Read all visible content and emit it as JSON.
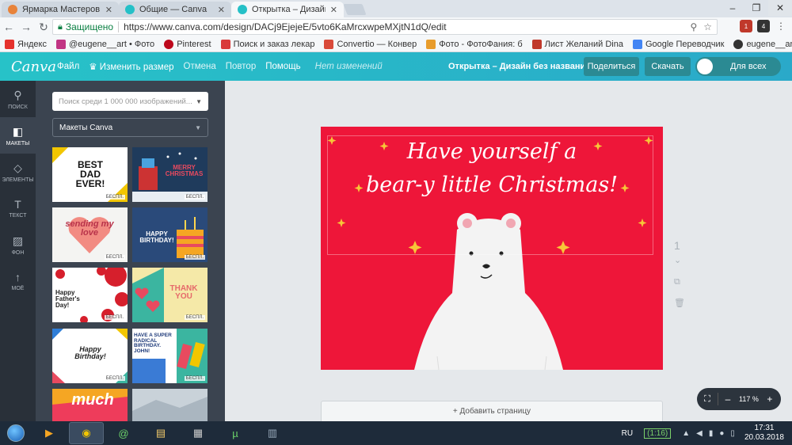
{
  "browser": {
    "tabs": [
      {
        "title": "Ярмарка Мастеров – ру",
        "favicon_color": "#e8833a",
        "active": false
      },
      {
        "title": "Общие — Canva",
        "favicon_color": "#25c0c7",
        "active": false
      },
      {
        "title": "Открытка – Дизайн без",
        "favicon_color": "#25c0c7",
        "active": true
      }
    ],
    "secure_label": "Защищено",
    "url": "https://www.canva.com/design/DACj9EjejeE/5vto6KaMrcxwpeMXjtN1dQ/edit",
    "bookmarks": [
      {
        "label": "Яндекс",
        "color": "#e5322d"
      },
      {
        "label": "@eugene__art • Фото",
        "color": "#c13584"
      },
      {
        "label": "Pinterest",
        "color": "#bd081c"
      },
      {
        "label": "Поиск и заказ лекар",
        "color": "#d93a3a"
      },
      {
        "label": "Convertio — Конвер",
        "color": "#d94a3a"
      },
      {
        "label": "Фото - ФотоФания: б",
        "color": "#e89c2c"
      },
      {
        "label": "Лист Желаний Dina",
        "color": "#c0392b"
      },
      {
        "label": "Google Переводчик",
        "color": "#4285f4"
      },
      {
        "label": "eugene__art | WEBST",
        "color": "#333333"
      }
    ],
    "ext_badges": [
      "1",
      "4"
    ]
  },
  "canva": {
    "logo": "Canva",
    "menu": {
      "file": "Файл",
      "resize": "Изменить размер",
      "undo": "Отмена",
      "redo": "Повтор",
      "help": "Помощь",
      "status": "Нет изменений"
    },
    "doc_title": "Открытка – Дизайн без названия",
    "share": "Поделиться",
    "download": "Скачать",
    "visibility": "Для всех"
  },
  "rail": [
    {
      "label": "ПОИСК",
      "icon": "search-icon",
      "glyph": "⚲"
    },
    {
      "label": "МАКЕТЫ",
      "icon": "layouts-icon",
      "glyph": "◧"
    },
    {
      "label": "ЭЛЕМЕНТЫ",
      "icon": "elements-icon",
      "glyph": "◇"
    },
    {
      "label": "ТЕКСТ",
      "icon": "text-icon",
      "glyph": "T"
    },
    {
      "label": "ФОН",
      "icon": "background-icon",
      "glyph": "▨"
    },
    {
      "label": "МОЁ",
      "icon": "upload-icon",
      "glyph": "↑"
    }
  ],
  "panel": {
    "search_placeholder": "Поиск среди 1 000 000 изображений...",
    "layouts_select": "Макеты Canva",
    "free_badge": "БЕСПЛ.",
    "templates": [
      {
        "text": "BEST DAD EVER!",
        "bg": "#ffffff",
        "fg": "#111111"
      },
      {
        "text": "MERRY CHRISTMAS",
        "bg": "#1f3b5c",
        "fg": "#e84a5f"
      },
      {
        "text": "sending my love",
        "bg": "#f4f4f2",
        "fg": "#e84a5f"
      },
      {
        "text": "HAPPY BIRTHDAY!",
        "bg": "#2a4a7a",
        "fg": "#ffffff"
      },
      {
        "text": "Happy Father's Day!",
        "bg": "#ffffff",
        "fg": "#222222"
      },
      {
        "text": "THANK YOU",
        "bg": "#f5e9a8",
        "fg": "#e66a6a"
      },
      {
        "text": "Happy Birthday!",
        "bg": "#ffffff",
        "fg": "#222222"
      },
      {
        "text": "HAVE A SUPER RADICAL BIRTHDAY. JOHN!",
        "bg": "#ffffff",
        "fg": "#1f3b7a"
      },
      {
        "text": "much",
        "bg": "#ee3c5b",
        "fg": "#ffffff"
      },
      {
        "text": "",
        "bg": "#c9d2d9",
        "fg": "#ffffff"
      }
    ]
  },
  "canvas": {
    "line1": "Have yourself a",
    "line2": "bear-y little Christmas!",
    "bg": "#ee1639",
    "page_number": "1",
    "add_page": "+ Добавить страницу",
    "zoom": "117 %"
  },
  "taskbar": {
    "apps": [
      {
        "icon": "media-player-icon",
        "glyph": "▶",
        "open": false
      },
      {
        "icon": "chrome-icon",
        "glyph": "◉",
        "open": true
      },
      {
        "icon": "mail-icon",
        "glyph": "@",
        "open": false
      },
      {
        "icon": "folder-icon",
        "glyph": "▤",
        "open": false
      },
      {
        "icon": "film-icon",
        "glyph": "▦",
        "open": false
      },
      {
        "icon": "utorrent-icon",
        "glyph": "µ",
        "open": false
      },
      {
        "icon": "calculator-icon",
        "glyph": "▥",
        "open": false
      }
    ],
    "lang": "RU",
    "battery": "(1:16)",
    "time": "17:31",
    "date": "20.03.2018"
  }
}
